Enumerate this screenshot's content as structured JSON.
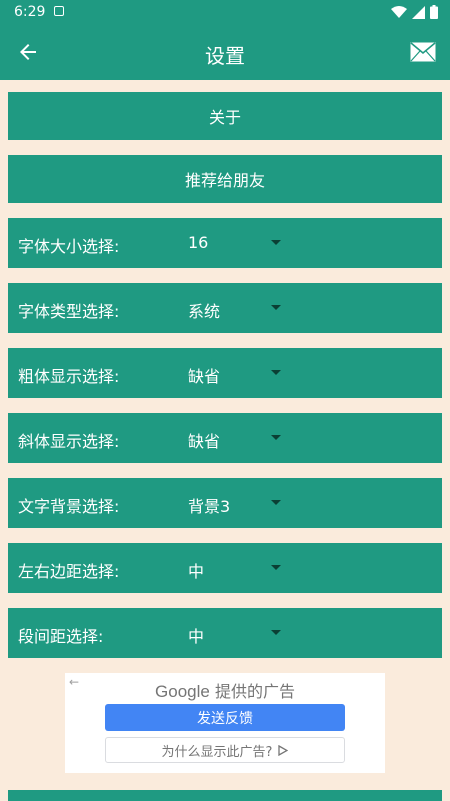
{
  "status_bar": {
    "time": "6:29",
    "icons": [
      "sim-card-icon",
      "wifi-icon",
      "cell-signal-icon",
      "battery-icon"
    ]
  },
  "app_bar": {
    "title": "设置",
    "back_icon": "arrow-left-icon",
    "mail_icon": "mail-icon"
  },
  "buttons": {
    "about": "关于",
    "recommend": "推荐给朋友"
  },
  "settings": [
    {
      "label": "字体大小选择:",
      "value": "16"
    },
    {
      "label": "字体类型选择:",
      "value": "系统"
    },
    {
      "label": "粗体显示选择:",
      "value": "缺省"
    },
    {
      "label": "斜体显示选择:",
      "value": "缺省"
    },
    {
      "label": "文字背景选择:",
      "value": "背景3"
    },
    {
      "label": "左右边距选择:",
      "value": "中"
    },
    {
      "label": "段间距选择:",
      "value": "中"
    }
  ],
  "ad": {
    "back_arrow": "←",
    "brand": "Google",
    "provider_suffix": "提供的广告",
    "feedback_button": "发送反馈",
    "why_link": "为什么显示此广告?",
    "why_icon": "play-outline-icon"
  },
  "colors": {
    "primary": "#1f9a82",
    "background": "#faebdc",
    "ad_button": "#4285f4"
  }
}
